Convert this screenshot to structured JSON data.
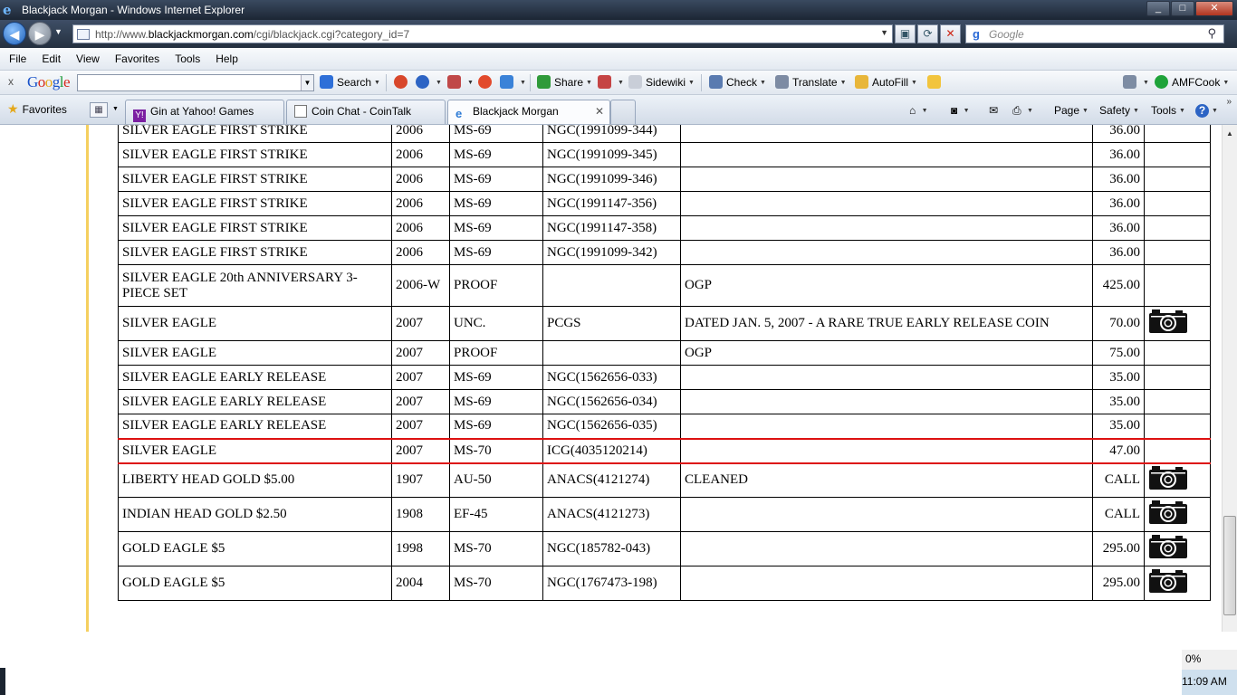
{
  "window": {
    "title": "Blackjack Morgan - Windows Internet Explorer",
    "minimize": "_",
    "maximize": "□",
    "close": "✕"
  },
  "address_bar": {
    "url_prefix": "http://www.",
    "url_domain": "blackjackmorgan.com",
    "url_suffix": "/cgi/blackjack.cgi?category_id=7",
    "search_placeholder": "Google"
  },
  "menu": [
    "File",
    "Edit",
    "View",
    "Favorites",
    "Tools",
    "Help"
  ],
  "google_toolbar": {
    "close": "x",
    "search_label": "Search",
    "share_label": "Share",
    "sidewiki_label": "Sidewiki",
    "check_label": "Check",
    "translate_label": "Translate",
    "autofill_label": "AutoFill",
    "account_label": "AMFCook"
  },
  "tabs": {
    "favorites_label": "Favorites",
    "items": [
      {
        "label": "Gin at Yahoo! Games"
      },
      {
        "label": "Coin Chat - CoinTalk"
      },
      {
        "label": "Blackjack Morgan",
        "close": "✕"
      }
    ],
    "page_label": "Page",
    "safety_label": "Safety",
    "tools_label": "Tools",
    "help_label": "?"
  },
  "listing": {
    "rows": [
      {
        "name": "SILVER EAGLE FIRST STRIKE",
        "year": "2006",
        "grade": "MS-69",
        "cert": "NGC(1991099-344)",
        "notes": "",
        "price": "36.00",
        "photo": false
      },
      {
        "name": "SILVER EAGLE FIRST STRIKE",
        "year": "2006",
        "grade": "MS-69",
        "cert": "NGC(1991099-345)",
        "notes": "",
        "price": "36.00",
        "photo": false
      },
      {
        "name": "SILVER EAGLE FIRST STRIKE",
        "year": "2006",
        "grade": "MS-69",
        "cert": "NGC(1991099-346)",
        "notes": "",
        "price": "36.00",
        "photo": false
      },
      {
        "name": "SILVER EAGLE FIRST STRIKE",
        "year": "2006",
        "grade": "MS-69",
        "cert": "NGC(1991147-356)",
        "notes": "",
        "price": "36.00",
        "photo": false
      },
      {
        "name": "SILVER EAGLE FIRST STRIKE",
        "year": "2006",
        "grade": "MS-69",
        "cert": "NGC(1991147-358)",
        "notes": "",
        "price": "36.00",
        "photo": false
      },
      {
        "name": "SILVER EAGLE FIRST STRIKE",
        "year": "2006",
        "grade": "MS-69",
        "cert": "NGC(1991099-342)",
        "notes": "",
        "price": "36.00",
        "photo": false
      },
      {
        "name": "SILVER EAGLE 20th ANNIVERSARY 3-PIECE SET",
        "year": "2006-W",
        "grade": "PROOF",
        "cert": "",
        "notes": "OGP",
        "price": "425.00",
        "photo": false,
        "tall": true
      },
      {
        "name": "SILVER EAGLE",
        "year": "2007",
        "grade": "UNC.",
        "cert": "PCGS",
        "notes": "DATED JAN. 5, 2007 - A RARE TRUE EARLY RELEASE COIN",
        "price": "70.00",
        "photo": true
      },
      {
        "name": "SILVER EAGLE",
        "year": "2007",
        "grade": "PROOF",
        "cert": "",
        "notes": "OGP",
        "price": "75.00",
        "photo": false
      },
      {
        "name": "SILVER EAGLE EARLY RELEASE",
        "year": "2007",
        "grade": "MS-69",
        "cert": "NGC(1562656-033)",
        "notes": "",
        "price": "35.00",
        "photo": false
      },
      {
        "name": "SILVER EAGLE EARLY RELEASE",
        "year": "2007",
        "grade": "MS-69",
        "cert": "NGC(1562656-034)",
        "notes": "",
        "price": "35.00",
        "photo": false
      },
      {
        "name": "SILVER EAGLE EARLY RELEASE",
        "year": "2007",
        "grade": "MS-69",
        "cert": "NGC(1562656-035)",
        "notes": "",
        "price": "35.00",
        "photo": false
      },
      {
        "name": "SILVER EAGLE",
        "year": "2007",
        "grade": "MS-70",
        "cert": "ICG(4035120214)",
        "notes": "",
        "price": "47.00",
        "photo": false,
        "highlight": true
      },
      {
        "name": "LIBERTY HEAD GOLD $5.00",
        "year": "1907",
        "grade": "AU-50",
        "cert": "ANACS(4121274)",
        "notes": "CLEANED",
        "price": "CALL",
        "photo": true
      },
      {
        "name": "INDIAN HEAD GOLD $2.50",
        "year": "1908",
        "grade": "EF-45",
        "cert": "ANACS(4121273)",
        "notes": "",
        "price": "CALL",
        "photo": true
      },
      {
        "name": "GOLD EAGLE $5",
        "year": "1998",
        "grade": "MS-70",
        "cert": "NGC(185782-043)",
        "notes": "",
        "price": "295.00",
        "photo": true
      },
      {
        "name": "GOLD EAGLE $5",
        "year": "2004",
        "grade": "MS-70",
        "cert": "NGC(1767473-198)",
        "notes": "",
        "price": "295.00",
        "photo": true
      }
    ]
  },
  "status": {
    "zoom": "0%",
    "clock": "11:09 AM"
  }
}
